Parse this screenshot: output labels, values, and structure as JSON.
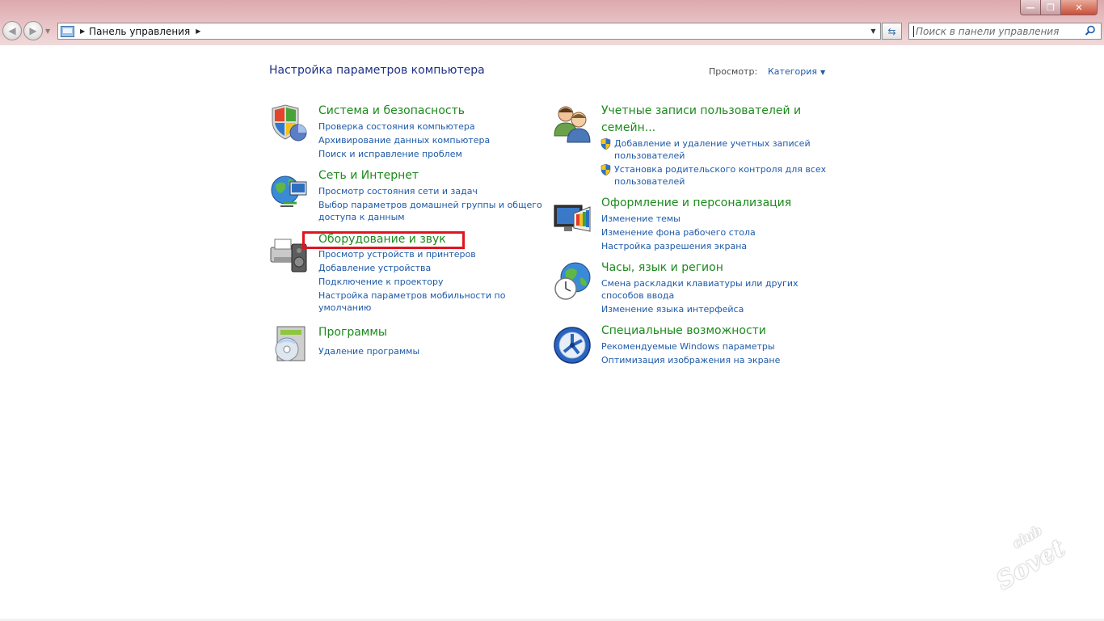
{
  "titlebar": {
    "minimize_glyph": "—",
    "maximize_glyph": "❐",
    "close_glyph": "✕"
  },
  "nav": {
    "back_glyph": "◀",
    "forward_glyph": "▶",
    "recent_glyph": "▼"
  },
  "address": {
    "separator_glyph": "▶",
    "breadcrumb": "Панель управления",
    "trailing_glyph": "▶",
    "dropdown_glyph": "▼",
    "refresh_glyph": "⇆"
  },
  "search": {
    "placeholder": "Поиск в панели управления"
  },
  "main": {
    "heading": "Настройка параметров компьютера",
    "view_by_label": "Просмотр:",
    "view_by_value": "Категория",
    "view_dropdown_glyph": "▼"
  },
  "categories": {
    "system": {
      "title": "Система и безопасность",
      "icon": "security-shield-icon",
      "links": [
        "Проверка состояния компьютера",
        "Архивирование данных компьютера",
        "Поиск и исправление проблем"
      ]
    },
    "network": {
      "title": "Сеть и Интернет",
      "icon": "network-globe-icon",
      "links": [
        "Просмотр состояния сети и задач",
        "Выбор параметров домашней группы и общего",
        "доступа к данным"
      ]
    },
    "hardware": {
      "title": "Оборудование и звук",
      "icon": "printer-speaker-icon",
      "links": [
        "Просмотр устройств и принтеров",
        "Добавление устройства",
        "Подключение к проектору",
        "Настройка параметров мобильности по",
        "умолчанию"
      ]
    },
    "programs": {
      "title": "Программы",
      "icon": "programs-disc-icon",
      "links": [
        "Удаление программы"
      ]
    },
    "accounts": {
      "title_line1": "Учетные записи пользователей и",
      "title_line2": "семейн...",
      "icon": "users-icon",
      "links": [
        "Добавление и удаление учетных записей",
        "пользователей",
        "Установка родительского контроля для всех",
        "пользователей"
      ]
    },
    "appearance": {
      "title": "Оформление и персонализация",
      "icon": "display-palette-icon",
      "links": [
        "Изменение темы",
        "Изменение фона рабочего стола",
        "Настройка разрешения экрана"
      ]
    },
    "clock": {
      "title": "Часы, язык и регион",
      "icon": "clock-globe-icon",
      "links": [
        "Смена раскладки клавиатуры или других",
        "способов ввода",
        "Изменение языка интерфейса"
      ]
    },
    "access": {
      "title": "Специальные возможности",
      "icon": "ease-of-access-icon",
      "links": [
        "Рекомендуемые Windows параметры",
        "Оптимизация изображения на экране"
      ]
    }
  },
  "annotation": {
    "highlight_color": "#e0151f"
  },
  "watermark": {
    "line1": "club",
    "line2": "Sovet"
  },
  "colors": {
    "title_green": "#1c8a1c",
    "link_blue": "#1e5aa8",
    "heading_blue": "#1e3287"
  }
}
